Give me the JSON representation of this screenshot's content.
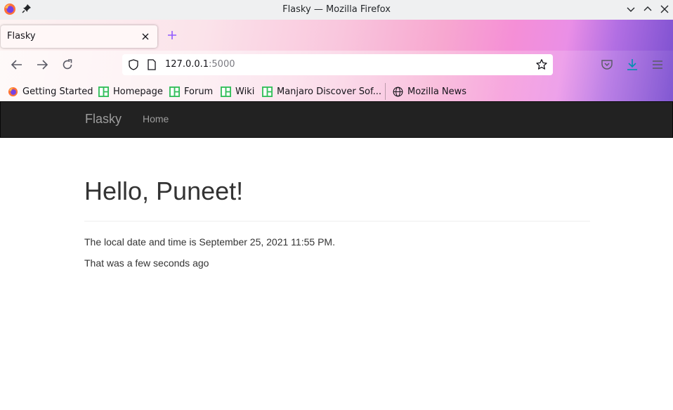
{
  "window": {
    "title": "Flasky — Mozilla Firefox"
  },
  "tab": {
    "title": "Flasky"
  },
  "urlbar": {
    "host": "127.0.0.1",
    "port": ":5000"
  },
  "bookmarks": [
    {
      "label": "Getting Started",
      "icon": "firefox-icon"
    },
    {
      "label": "Homepage",
      "icon": "manjaro-icon"
    },
    {
      "label": "Forum",
      "icon": "manjaro-icon"
    },
    {
      "label": "Wiki",
      "icon": "manjaro-icon"
    },
    {
      "label": "Manjaro Discover Sof...",
      "icon": "manjaro-icon"
    },
    {
      "label": "Mozilla News",
      "icon": "globe-icon"
    }
  ],
  "page": {
    "navbar": {
      "brand": "Flasky",
      "links": [
        "Home"
      ]
    },
    "heading": "Hello, Puneet!",
    "datetime_text": "The local date and time is September 25, 2021 11:55 PM.",
    "relative_text": "That was a few seconds ago"
  },
  "colors": {
    "navbar_bg": "#222222",
    "navbar_text": "#9d9d9d",
    "accent_purple": "#9059ff",
    "manjaro_green": "#35bf5c"
  }
}
